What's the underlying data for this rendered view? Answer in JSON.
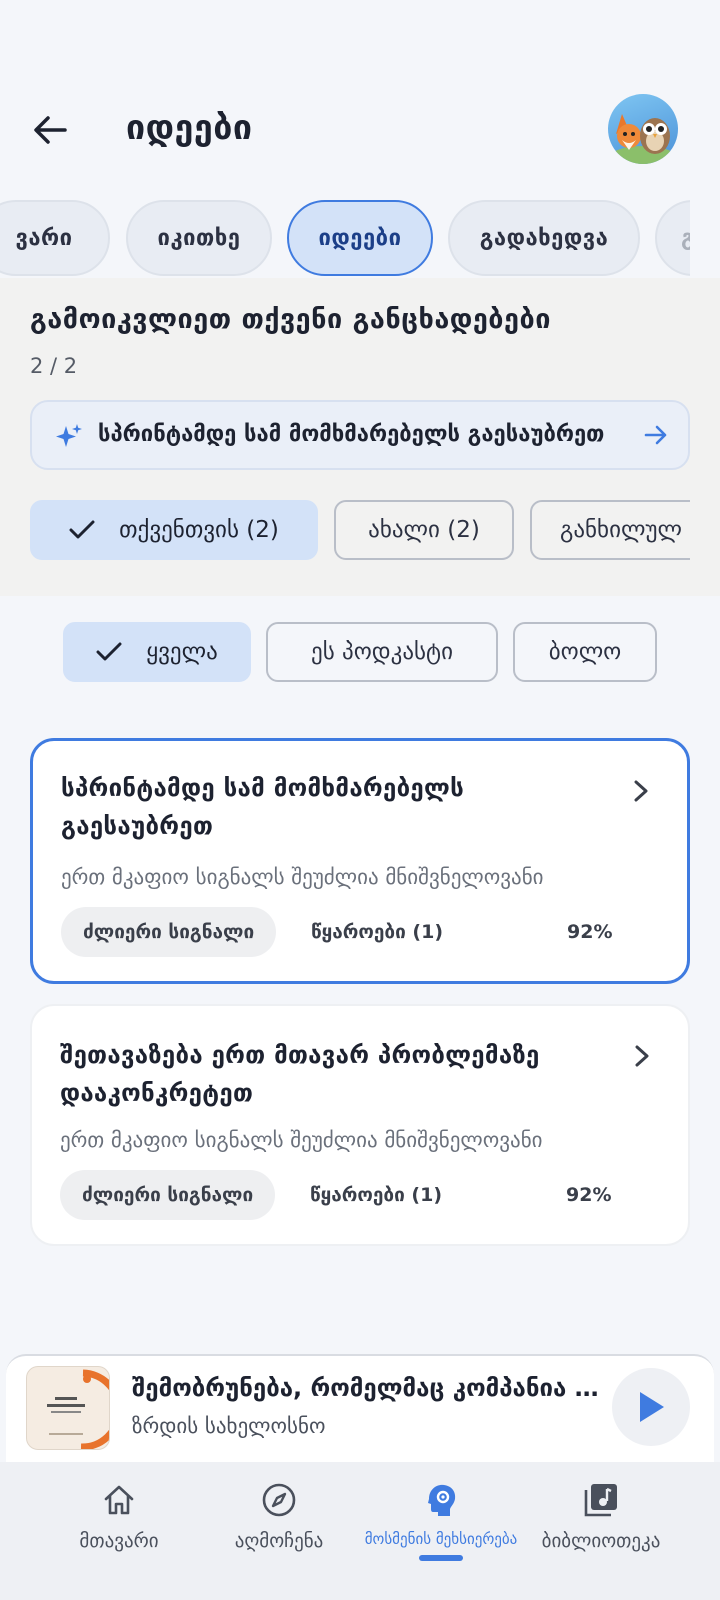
{
  "header": {
    "title": "იდეები"
  },
  "tabs": [
    {
      "label": "ვარი"
    },
    {
      "label": "იკითხე"
    },
    {
      "label": "იდეები",
      "active": true
    },
    {
      "label": "გადახედვა"
    },
    {
      "label": "გ"
    }
  ],
  "section": {
    "title": "გამოიკვლიეთ თქვენი განცხადებები",
    "count": "2 / 2",
    "banner_text": "სპრინტამდე სამ მომხმარებელს გაესაუბრეთ"
  },
  "filters": [
    {
      "label": "თქვენთვის (2)",
      "selected": true
    },
    {
      "label": "ახალი (2)"
    },
    {
      "label": "განხილულ"
    }
  ],
  "scope_filters": [
    {
      "label": "ყველა",
      "selected": true
    },
    {
      "label": "ეს პოდკასტი"
    },
    {
      "label": "ბოლო"
    }
  ],
  "cards": [
    {
      "title": "სპრინტამდე სამ მომხმარებელს გაესაუბრეთ",
      "description": "ერთ მკაფიო სიგნალს შეუძლია მნიშვნელოვანი",
      "badge": "ძლიერი სიგნალი",
      "sources": "წყაროები (1)",
      "percent": "92%",
      "selected": true
    },
    {
      "title": "შეთავაზება ერთ მთავარ პრობლემაზე დააკონკრეტეთ",
      "description": "ერთ მკაფიო სიგნალს შეუძლია მნიშვნელოვანი",
      "badge": "ძლიერი სიგნალი",
      "sources": "წყაროები (1)",
      "percent": "92%",
      "selected": false
    }
  ],
  "player": {
    "title": "შემობრუნება, რომელმაც კომპანია გადაარჩინა",
    "subtitle": "ზრდის სახელოსნო"
  },
  "nav": [
    {
      "label": "მთავარი",
      "icon": "home-icon"
    },
    {
      "label": "აღმოჩენა",
      "icon": "compass-icon"
    },
    {
      "label": "მოსმენის მეხსიერება",
      "icon": "brain-gear-icon",
      "active": true
    },
    {
      "label": "ბიბლიოთეკა",
      "icon": "music-library-icon"
    }
  ],
  "colors": {
    "accent": "#3f7be0",
    "chip_selected": "#d3e2f8",
    "background": "#f4f6fa"
  }
}
